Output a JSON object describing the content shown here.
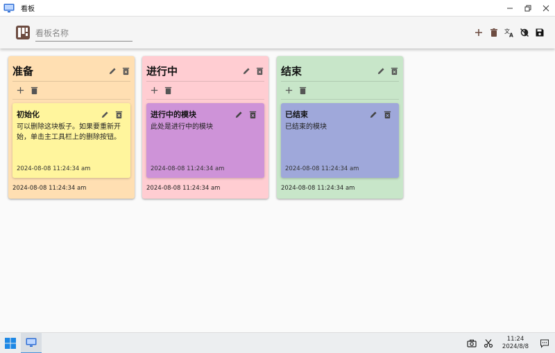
{
  "window": {
    "title": "看板"
  },
  "toolbar": {
    "board_name_placeholder": "看板名称",
    "board_name_value": ""
  },
  "columns": [
    {
      "title": "准备",
      "color": "#FFDFB2",
      "footer_date": "2024-08-08 11:24:34 am",
      "card": {
        "title": "初始化",
        "body": "可以删除这块板子。如果要重新开始，单击主工具栏上的删除按钮。",
        "date": "2024-08-08 11:24:34 am",
        "color": "#FFF59D"
      }
    },
    {
      "title": "进行中",
      "color": "#FFCDD2",
      "footer_date": "2024-08-08 11:24:34 am",
      "card": {
        "title": "进行中的模块",
        "body": "此处是进行中的模块",
        "date": "2024-08-08 11:24:34 am",
        "color": "#CE93D8"
      }
    },
    {
      "title": "结束",
      "color": "#C8E6C9",
      "footer_date": "2024-08-08 11:24:34 am",
      "card": {
        "title": "已结束",
        "body": "已结束的模块",
        "date": "2024-08-08 11:24:34 am",
        "color": "#9FA8DA"
      }
    }
  ],
  "taskbar": {
    "time": "11:24",
    "date": "2024/8/8"
  },
  "icons": {
    "toolbar": [
      "plus-icon",
      "trash-icon",
      "translate-icon",
      "theme-toggle-icon",
      "save-icon"
    ],
    "tray": [
      "camera-icon",
      "scissors-icon",
      "notification-icon"
    ]
  }
}
